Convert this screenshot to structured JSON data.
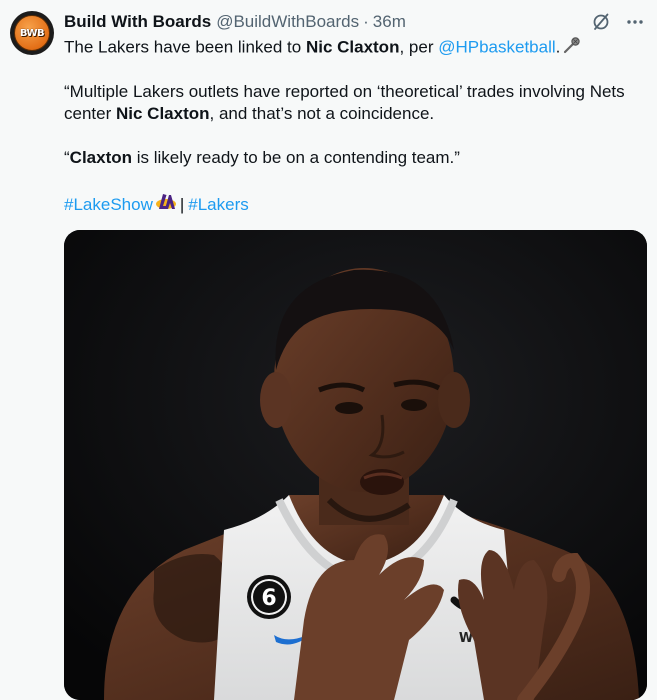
{
  "author": {
    "display_name": "Build With Boards",
    "handle": "@BuildWithBoards",
    "separator": "·",
    "time": "36m",
    "avatar_text": "BWB"
  },
  "tweet": {
    "line1_prefix": "The Lakers have been linked to ",
    "line1_bold": "Nic Claxton",
    "line1_middle": ", per ",
    "line1_mention": "@HPbasketball",
    "line1_suffix": ".",
    "para2_prefix": "“Multiple Lakers outlets have reported on ‘theoretical’ trades involving Nets center ",
    "para2_bold": "Nic Claxton",
    "para2_suffix": ", and that’s not a coincidence.",
    "para3_prefix": "“",
    "para3_bold": "Claxton",
    "para3_suffix": " is likely ready to be on a contending team.”",
    "hashtag1": "#LakeShow",
    "hashtag_separator": "|",
    "hashtag2": "#Lakers"
  },
  "media": {
    "jersey_number": "6",
    "sponsor_text": "Webull"
  },
  "icons": {
    "grok": "grok-icon",
    "more": "more-icon",
    "microphone": "microphone-emoji",
    "lakers": "lakers-logo-emoji"
  },
  "colors": {
    "link": "#1d9bf0",
    "secondary_text": "#536471",
    "background": "#f7f9f9"
  }
}
